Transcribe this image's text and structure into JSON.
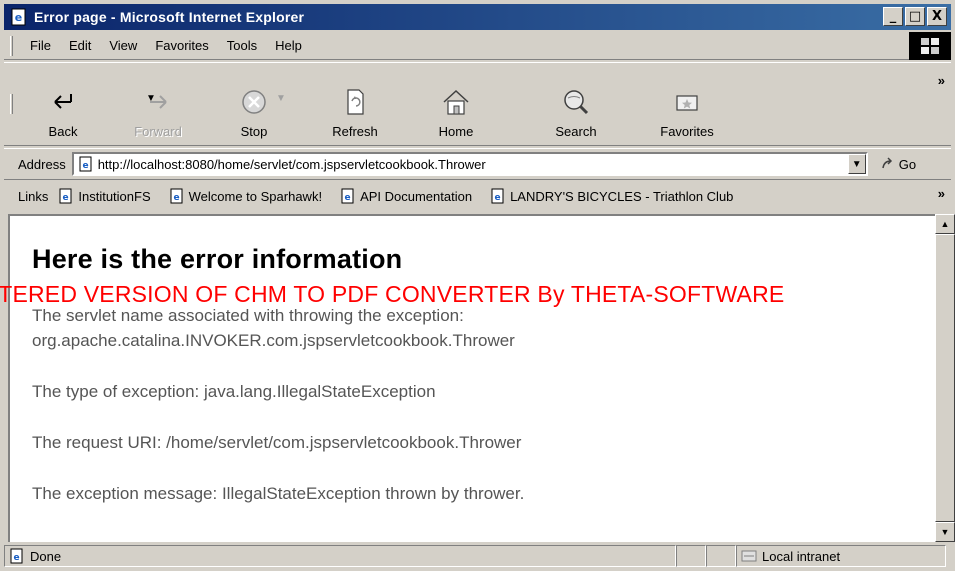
{
  "window": {
    "title": "Error page - Microsoft Internet Explorer",
    "controls": [
      "_",
      "□",
      "X"
    ]
  },
  "menu": {
    "items": [
      "File",
      "Edit",
      "View",
      "Favorites",
      "Tools",
      "Help"
    ]
  },
  "toolbar": {
    "back": "Back",
    "forward": "Forward",
    "stop": "Stop",
    "refresh": "Refresh",
    "home": "Home",
    "search": "Search",
    "favorites": "Favorites",
    "more": "»"
  },
  "address": {
    "label": "Address",
    "url": "http://localhost:8080/home/servlet/com.jspservletcookbook.Thrower",
    "go": "Go"
  },
  "links": {
    "label": "Links",
    "items": [
      "InstitutionFS",
      "Welcome to Sparhawk!",
      "API Documentation",
      "LANDRY'S BICYCLES - Triathlon Club"
    ],
    "more": "»"
  },
  "page": {
    "heading": "Here is the error information",
    "servlet_line1": "The servlet name associated with throwing the exception:",
    "servlet_line2": "org.apache.catalina.INVOKER.com.jspservletcookbook.Thrower",
    "exception_type": "The type of exception: java.lang.IllegalStateException",
    "request_uri": "The request URI: /home/servlet/com.jspservletcookbook.Thrower",
    "exception_message": "The exception message: IllegalStateException thrown by thrower.",
    "watermark": "UNREGISTERED VERSION OF CHM TO PDF CONVERTER By THETA-SOFTWARE"
  },
  "status": {
    "text": "Done",
    "zone": "Local intranet"
  },
  "colors": {
    "titlebar_start": "#0a246a",
    "titlebar_end": "#3a6ea5",
    "chrome": "#d4d0c8",
    "watermark": "#ff0000"
  }
}
